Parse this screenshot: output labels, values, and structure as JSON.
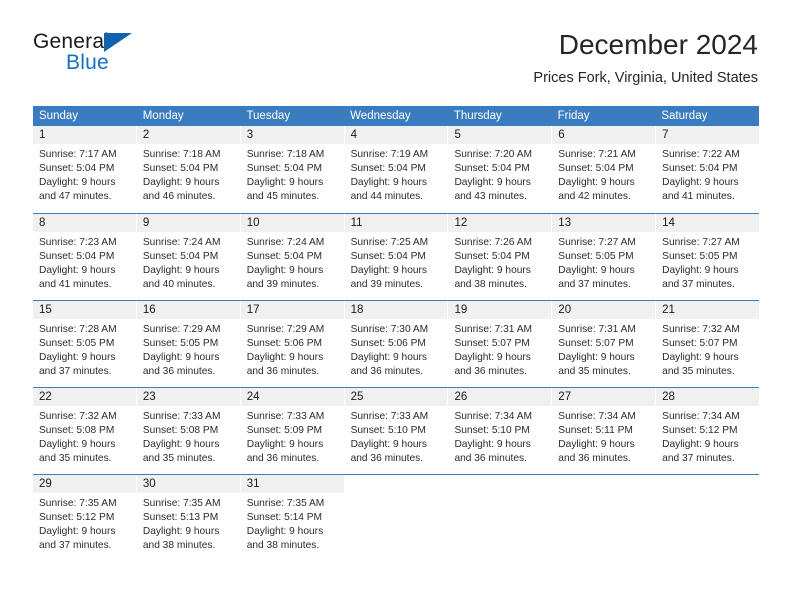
{
  "logo": {
    "primary_text": "General",
    "secondary_text": "Blue",
    "triangle_color": "#1263ad",
    "secondary_color": "#1570c0"
  },
  "header": {
    "month_title": "December 2024",
    "location": "Prices Fork, Virginia, United States"
  },
  "theme": {
    "header_row_bg": "#3a7cc0",
    "day_number_bg": "#f0f0f0",
    "row_divider": "#3a7cc0",
    "text": "#2b2b2b"
  },
  "calendar": {
    "day_names": [
      "Sunday",
      "Monday",
      "Tuesday",
      "Wednesday",
      "Thursday",
      "Friday",
      "Saturday"
    ],
    "weeks": [
      [
        {
          "day": "1",
          "sunrise": "Sunrise: 7:17 AM",
          "sunset": "Sunset: 5:04 PM",
          "daylight_line1": "Daylight: 9 hours",
          "daylight_line2": "and 47 minutes."
        },
        {
          "day": "2",
          "sunrise": "Sunrise: 7:18 AM",
          "sunset": "Sunset: 5:04 PM",
          "daylight_line1": "Daylight: 9 hours",
          "daylight_line2": "and 46 minutes."
        },
        {
          "day": "3",
          "sunrise": "Sunrise: 7:18 AM",
          "sunset": "Sunset: 5:04 PM",
          "daylight_line1": "Daylight: 9 hours",
          "daylight_line2": "and 45 minutes."
        },
        {
          "day": "4",
          "sunrise": "Sunrise: 7:19 AM",
          "sunset": "Sunset: 5:04 PM",
          "daylight_line1": "Daylight: 9 hours",
          "daylight_line2": "and 44 minutes."
        },
        {
          "day": "5",
          "sunrise": "Sunrise: 7:20 AM",
          "sunset": "Sunset: 5:04 PM",
          "daylight_line1": "Daylight: 9 hours",
          "daylight_line2": "and 43 minutes."
        },
        {
          "day": "6",
          "sunrise": "Sunrise: 7:21 AM",
          "sunset": "Sunset: 5:04 PM",
          "daylight_line1": "Daylight: 9 hours",
          "daylight_line2": "and 42 minutes."
        },
        {
          "day": "7",
          "sunrise": "Sunrise: 7:22 AM",
          "sunset": "Sunset: 5:04 PM",
          "daylight_line1": "Daylight: 9 hours",
          "daylight_line2": "and 41 minutes."
        }
      ],
      [
        {
          "day": "8",
          "sunrise": "Sunrise: 7:23 AM",
          "sunset": "Sunset: 5:04 PM",
          "daylight_line1": "Daylight: 9 hours",
          "daylight_line2": "and 41 minutes."
        },
        {
          "day": "9",
          "sunrise": "Sunrise: 7:24 AM",
          "sunset": "Sunset: 5:04 PM",
          "daylight_line1": "Daylight: 9 hours",
          "daylight_line2": "and 40 minutes."
        },
        {
          "day": "10",
          "sunrise": "Sunrise: 7:24 AM",
          "sunset": "Sunset: 5:04 PM",
          "daylight_line1": "Daylight: 9 hours",
          "daylight_line2": "and 39 minutes."
        },
        {
          "day": "11",
          "sunrise": "Sunrise: 7:25 AM",
          "sunset": "Sunset: 5:04 PM",
          "daylight_line1": "Daylight: 9 hours",
          "daylight_line2": "and 39 minutes."
        },
        {
          "day": "12",
          "sunrise": "Sunrise: 7:26 AM",
          "sunset": "Sunset: 5:04 PM",
          "daylight_line1": "Daylight: 9 hours",
          "daylight_line2": "and 38 minutes."
        },
        {
          "day": "13",
          "sunrise": "Sunrise: 7:27 AM",
          "sunset": "Sunset: 5:05 PM",
          "daylight_line1": "Daylight: 9 hours",
          "daylight_line2": "and 37 minutes."
        },
        {
          "day": "14",
          "sunrise": "Sunrise: 7:27 AM",
          "sunset": "Sunset: 5:05 PM",
          "daylight_line1": "Daylight: 9 hours",
          "daylight_line2": "and 37 minutes."
        }
      ],
      [
        {
          "day": "15",
          "sunrise": "Sunrise: 7:28 AM",
          "sunset": "Sunset: 5:05 PM",
          "daylight_line1": "Daylight: 9 hours",
          "daylight_line2": "and 37 minutes."
        },
        {
          "day": "16",
          "sunrise": "Sunrise: 7:29 AM",
          "sunset": "Sunset: 5:05 PM",
          "daylight_line1": "Daylight: 9 hours",
          "daylight_line2": "and 36 minutes."
        },
        {
          "day": "17",
          "sunrise": "Sunrise: 7:29 AM",
          "sunset": "Sunset: 5:06 PM",
          "daylight_line1": "Daylight: 9 hours",
          "daylight_line2": "and 36 minutes."
        },
        {
          "day": "18",
          "sunrise": "Sunrise: 7:30 AM",
          "sunset": "Sunset: 5:06 PM",
          "daylight_line1": "Daylight: 9 hours",
          "daylight_line2": "and 36 minutes."
        },
        {
          "day": "19",
          "sunrise": "Sunrise: 7:31 AM",
          "sunset": "Sunset: 5:07 PM",
          "daylight_line1": "Daylight: 9 hours",
          "daylight_line2": "and 36 minutes."
        },
        {
          "day": "20",
          "sunrise": "Sunrise: 7:31 AM",
          "sunset": "Sunset: 5:07 PM",
          "daylight_line1": "Daylight: 9 hours",
          "daylight_line2": "and 35 minutes."
        },
        {
          "day": "21",
          "sunrise": "Sunrise: 7:32 AM",
          "sunset": "Sunset: 5:07 PM",
          "daylight_line1": "Daylight: 9 hours",
          "daylight_line2": "and 35 minutes."
        }
      ],
      [
        {
          "day": "22",
          "sunrise": "Sunrise: 7:32 AM",
          "sunset": "Sunset: 5:08 PM",
          "daylight_line1": "Daylight: 9 hours",
          "daylight_line2": "and 35 minutes."
        },
        {
          "day": "23",
          "sunrise": "Sunrise: 7:33 AM",
          "sunset": "Sunset: 5:08 PM",
          "daylight_line1": "Daylight: 9 hours",
          "daylight_line2": "and 35 minutes."
        },
        {
          "day": "24",
          "sunrise": "Sunrise: 7:33 AM",
          "sunset": "Sunset: 5:09 PM",
          "daylight_line1": "Daylight: 9 hours",
          "daylight_line2": "and 36 minutes."
        },
        {
          "day": "25",
          "sunrise": "Sunrise: 7:33 AM",
          "sunset": "Sunset: 5:10 PM",
          "daylight_line1": "Daylight: 9 hours",
          "daylight_line2": "and 36 minutes."
        },
        {
          "day": "26",
          "sunrise": "Sunrise: 7:34 AM",
          "sunset": "Sunset: 5:10 PM",
          "daylight_line1": "Daylight: 9 hours",
          "daylight_line2": "and 36 minutes."
        },
        {
          "day": "27",
          "sunrise": "Sunrise: 7:34 AM",
          "sunset": "Sunset: 5:11 PM",
          "daylight_line1": "Daylight: 9 hours",
          "daylight_line2": "and 36 minutes."
        },
        {
          "day": "28",
          "sunrise": "Sunrise: 7:34 AM",
          "sunset": "Sunset: 5:12 PM",
          "daylight_line1": "Daylight: 9 hours",
          "daylight_line2": "and 37 minutes."
        }
      ],
      [
        {
          "day": "29",
          "sunrise": "Sunrise: 7:35 AM",
          "sunset": "Sunset: 5:12 PM",
          "daylight_line1": "Daylight: 9 hours",
          "daylight_line2": "and 37 minutes."
        },
        {
          "day": "30",
          "sunrise": "Sunrise: 7:35 AM",
          "sunset": "Sunset: 5:13 PM",
          "daylight_line1": "Daylight: 9 hours",
          "daylight_line2": "and 38 minutes."
        },
        {
          "day": "31",
          "sunrise": "Sunrise: 7:35 AM",
          "sunset": "Sunset: 5:14 PM",
          "daylight_line1": "Daylight: 9 hours",
          "daylight_line2": "and 38 minutes."
        },
        {
          "day": "",
          "sunrise": "",
          "sunset": "",
          "daylight_line1": "",
          "daylight_line2": ""
        },
        {
          "day": "",
          "sunrise": "",
          "sunset": "",
          "daylight_line1": "",
          "daylight_line2": ""
        },
        {
          "day": "",
          "sunrise": "",
          "sunset": "",
          "daylight_line1": "",
          "daylight_line2": ""
        },
        {
          "day": "",
          "sunrise": "",
          "sunset": "",
          "daylight_line1": "",
          "daylight_line2": ""
        }
      ]
    ]
  }
}
